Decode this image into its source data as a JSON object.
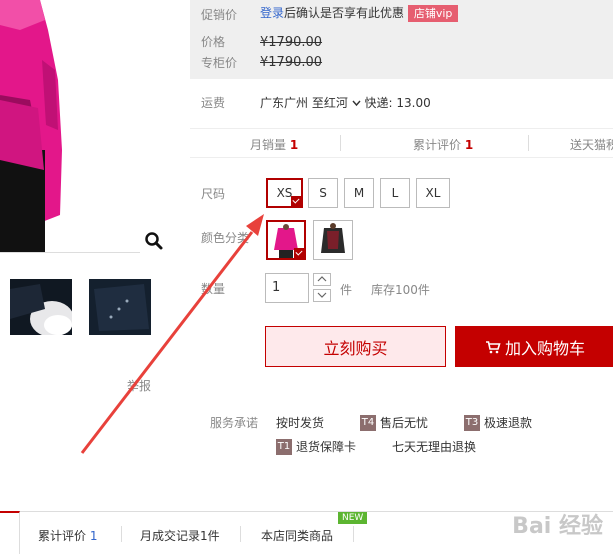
{
  "promo": {
    "label": "促销价",
    "login": "登录",
    "text": "后确认是否享有此优惠",
    "vip": "店铺vip"
  },
  "price": {
    "label": "价格",
    "value": "¥1790.00",
    "counter_label": "专柜价",
    "counter_value": "¥1790.00"
  },
  "shipping": {
    "label": "运费",
    "from": "广东广州",
    "to": "至红河",
    "express": "快递: 13.00"
  },
  "stats": {
    "monthly_label": "月销量",
    "monthly_value": "1",
    "reviews_label": "累计评价",
    "reviews_value": "1",
    "points_label": "送天猫积"
  },
  "size": {
    "label": "尺码",
    "options": [
      "XS",
      "S",
      "M",
      "L",
      "XL"
    ],
    "selected": "XS"
  },
  "color": {
    "label": "颜色分类"
  },
  "quantity": {
    "label": "数量",
    "value": "1",
    "unit": "件",
    "stock": "库存100件"
  },
  "actions": {
    "buy_now": "立刻购买",
    "add_cart": "加入购物车"
  },
  "service": {
    "label": "服务承诺",
    "items": [
      "按时发货",
      "售后无忧",
      "极速退款",
      "退货保障卡",
      "七天无理由退换"
    ],
    "icons": [
      "T4",
      "T3",
      "T1"
    ]
  },
  "report": "举报",
  "tabs": {
    "reviews_label": "累计评价",
    "reviews_count": "1",
    "monthly_label": "月成交记录1件",
    "same_label": "本店同类商品",
    "new_badge": "NEW"
  },
  "watermark": "Bai 经验",
  "colors": {
    "accent": "#c40000",
    "link": "#3366cc",
    "vip": "#e65e70",
    "new": "#5cb531",
    "annotation_arrow": "#e8413b"
  },
  "icons": [
    "search-icon",
    "cart-icon",
    "chevron-down-icon",
    "arrow-up-icon",
    "arrow-down-icon",
    "check-icon"
  ]
}
